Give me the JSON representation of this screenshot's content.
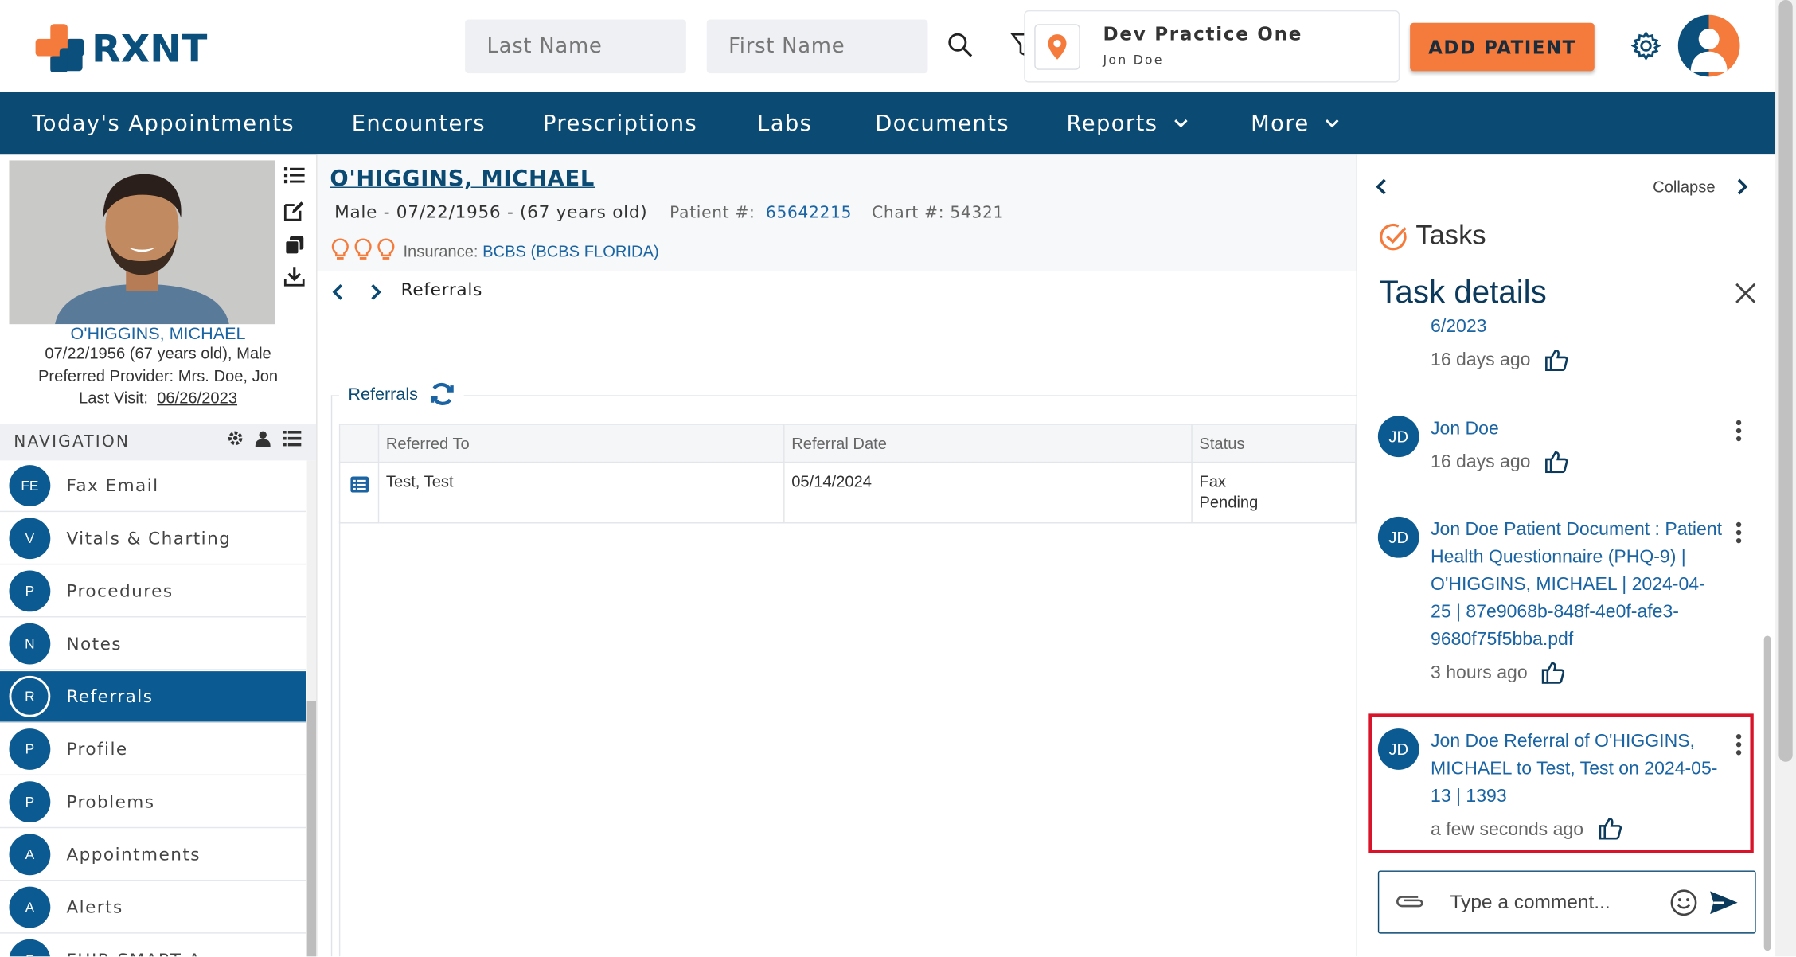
{
  "brand": {
    "name": "RXNT",
    "accent": "#f47b3c",
    "primary": "#0b4a73"
  },
  "search": {
    "last_name_placeholder": "Last Name",
    "first_name_placeholder": "First Name"
  },
  "practice": {
    "name": "Dev Practice One",
    "user": "Jon Doe"
  },
  "header": {
    "add_patient": "ADD PATIENT"
  },
  "nav": {
    "items": [
      {
        "label": "Today's Appointments"
      },
      {
        "label": "Encounters"
      },
      {
        "label": "Prescriptions"
      },
      {
        "label": "Labs"
      },
      {
        "label": "Documents"
      },
      {
        "label": "Reports"
      },
      {
        "label": "More"
      }
    ]
  },
  "patient": {
    "name": "O'HIGGINS, MICHAEL",
    "dob_line": "07/22/1956 (67 years old), Male",
    "provider_line": "Preferred Provider: Mrs. Doe, Jon",
    "last_visit_label": "Last Visit:",
    "last_visit": "06/26/2023",
    "header_name": "O'HIGGINS, MICHAEL",
    "demo": "Male - 07/22/1956 - (67 years old)",
    "patient_num_label": "Patient #:",
    "patient_num": "65642215",
    "chart_num": "Chart #: 54321",
    "insurance_label": "Insurance:",
    "insurance": "BCBS (BCBS FLORIDA)"
  },
  "navigation": {
    "title": "NAVIGATION",
    "items": [
      {
        "badge": "FE",
        "label": "Fax Email"
      },
      {
        "badge": "V",
        "label": "Vitals & Charting"
      },
      {
        "badge": "P",
        "label": "Procedures"
      },
      {
        "badge": "N",
        "label": "Notes"
      },
      {
        "badge": "R",
        "label": "Referrals"
      },
      {
        "badge": "P",
        "label": "Profile"
      },
      {
        "badge": "P",
        "label": "Problems"
      },
      {
        "badge": "A",
        "label": "Appointments"
      },
      {
        "badge": "A",
        "label": "Alerts"
      },
      {
        "badge": "F",
        "label": "FHIR SMART A"
      }
    ]
  },
  "breadcrumb": {
    "current": "Referrals"
  },
  "referrals": {
    "title": "Referrals",
    "columns": [
      "Referred To",
      "Referral Date",
      "Status"
    ],
    "rows": [
      {
        "referred_to": "Test, Test",
        "date": "05/14/2024",
        "status_line1": "Fax",
        "status_line2": "Pending"
      }
    ]
  },
  "tasks": {
    "collapse": "Collapse",
    "title": "Tasks",
    "details_title": "Task details",
    "partial_link": "6/2023",
    "partial_time": "16 days ago",
    "comments": [
      {
        "initials": "JD",
        "text": "Jon Doe",
        "time": "16 days ago"
      },
      {
        "initials": "JD",
        "text_lines": [
          "Jon Doe Patient Document : Patient",
          "Health Questionnaire (PHQ-9) |",
          "O'HIGGINS, MICHAEL | 2024-04-",
          "25 | 87e9068b-848f-4e0f-afe3-",
          "9680f75f5bba.pdf"
        ],
        "time": "3 hours ago"
      },
      {
        "initials": "JD",
        "text_lines": [
          "Jon Doe Referral of O'HIGGINS,",
          "MICHAEL to Test, Test on 2024-05-",
          "13 | 1393"
        ],
        "time": "a few seconds ago"
      }
    ],
    "comment_placeholder": "Type a comment..."
  }
}
